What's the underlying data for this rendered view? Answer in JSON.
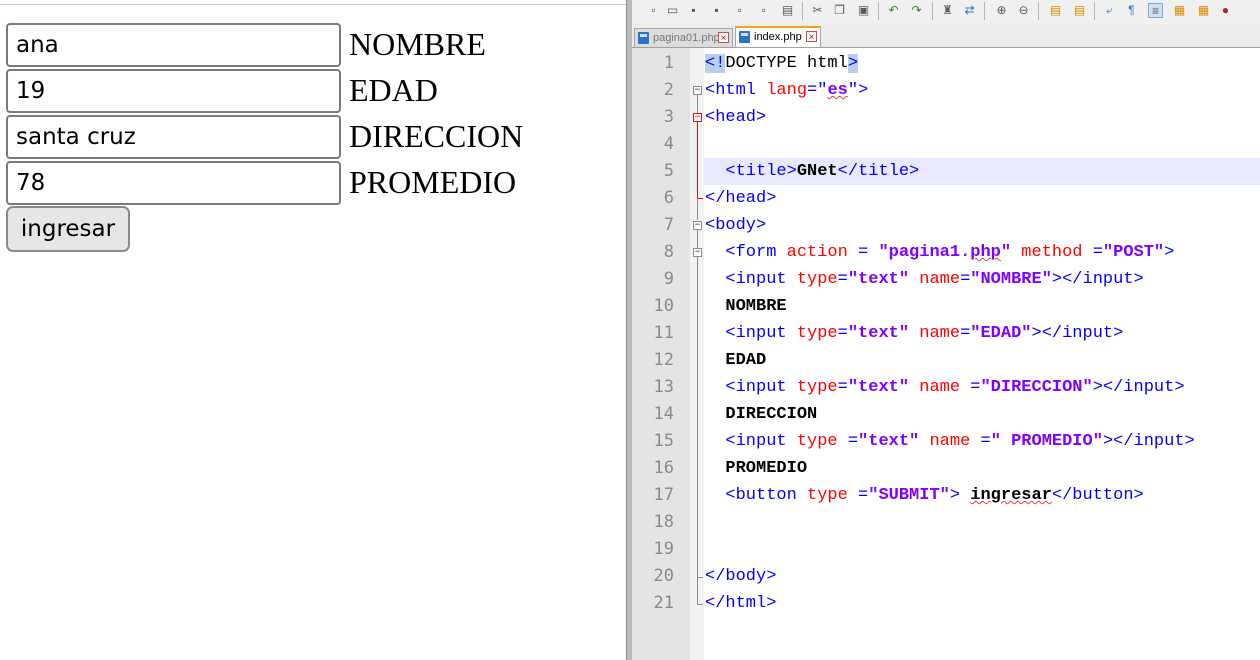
{
  "form": {
    "fields": [
      {
        "value": "ana",
        "label": "NOMBRE"
      },
      {
        "value": "19",
        "label": "EDAD"
      },
      {
        "value": "santa cruz",
        "label": "DIRECCION"
      },
      {
        "value": "78",
        "label": "PROMEDIO"
      }
    ],
    "submit_label": "ingresar"
  },
  "editor": {
    "tabs": [
      {
        "label": "pagina01.php",
        "active": false
      },
      {
        "label": "index.php",
        "active": true
      }
    ],
    "line_numbers": [
      "1",
      "2",
      "3",
      "4",
      "5",
      "6",
      "7",
      "8",
      "9",
      "10",
      "11",
      "12",
      "13",
      "14",
      "15",
      "16",
      "17",
      "18",
      "19",
      "20",
      "21"
    ],
    "tokens": {
      "l1_a": "<!",
      "l1_b": "DOCTYPE html",
      "l1_c": ">",
      "l2_a": "<html ",
      "l2_b": "lang",
      "l2_c": "=\"",
      "l2_d": "es",
      "l2_e": "\">",
      "l3": "<head>",
      "l5_a": "<title>",
      "l5_b": "GNet",
      "l5_c": "</title>",
      "l6": "</head>",
      "l7": "<body>",
      "l8_a": "<form ",
      "l8_b": "action",
      "l8_c": " = ",
      "l8_d": "\"pagina1.",
      "l8_e": "php",
      "l8_f": "\"",
      "l8_g": " method",
      "l8_h": " =",
      "l8_i": "\"POST\"",
      "l8_j": ">",
      "l9_a": "<input ",
      "l9_b": "type",
      "l9_c": "=",
      "l9_d": "\"text\"",
      "l9_e": " name",
      "l9_f": "=",
      "l9_g": "\"NOMBRE\"",
      "l9_h": "></input>",
      "l10": "NOMBRE",
      "l11_a": "<input ",
      "l11_b": "type",
      "l11_c": "=",
      "l11_d": "\"text\"",
      "l11_e": " name",
      "l11_f": "=",
      "l11_g": "\"EDAD\"",
      "l11_h": "></input>",
      "l12": "EDAD",
      "l13_a": "<input ",
      "l13_b": "type",
      "l13_c": "=",
      "l13_d": "\"text\"",
      "l13_e": " name",
      "l13_f": " =",
      "l13_g": "\"DIRECCION\"",
      "l13_h": "></input>",
      "l14": "DIRECCION",
      "l15_a": "<input ",
      "l15_b": "type",
      "l15_c": " =",
      "l15_d": "\"text\"",
      "l15_e": " name",
      "l15_f": " =",
      "l15_g": "\" PROMEDIO\"",
      "l15_h": "></input>",
      "l16": "PROMEDIO",
      "l17_a": "<button ",
      "l17_b": "type",
      "l17_c": " =",
      "l17_d": "\"SUBMIT\"",
      "l17_e": "> ",
      "l17_f": "ingresar",
      "l17_g": "</button>",
      "l20": "</body>",
      "l21": "</html>"
    }
  }
}
